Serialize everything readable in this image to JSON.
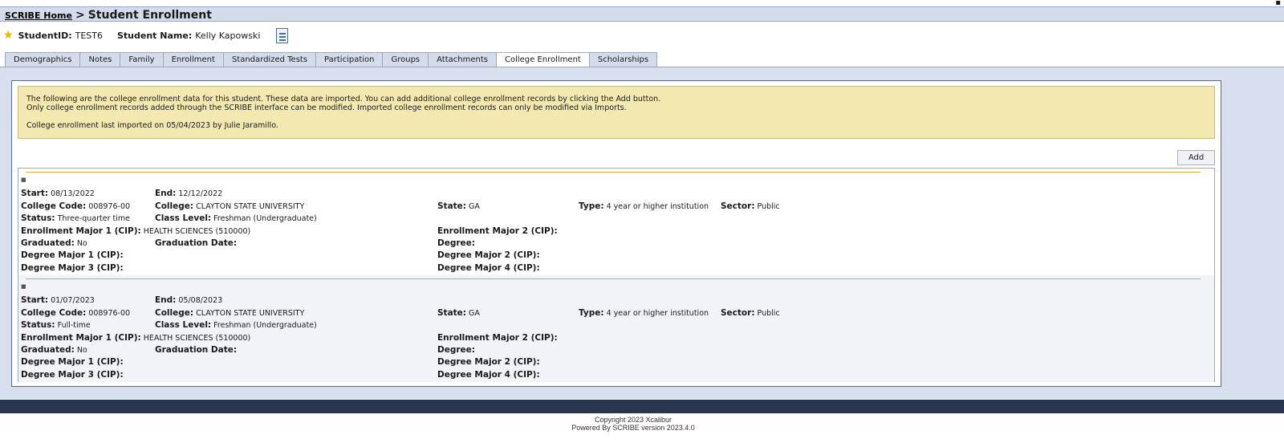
{
  "breadcrumb": {
    "home": "SCRIBE Home",
    "separator": ">",
    "title": "Student Enrollment"
  },
  "student": {
    "id_label": "StudentID:",
    "id_value": "TEST6",
    "name_label": "Student Name:",
    "name_value": "Kelly Kapowski"
  },
  "tabs": [
    "Demographics",
    "Notes",
    "Family",
    "Enrollment",
    "Standardized Tests",
    "Participation",
    "Groups",
    "Attachments",
    "College Enrollment",
    "Scholarships"
  ],
  "active_tab": "College Enrollment",
  "notice": {
    "line1": "The following are the college enrollment data for this student. These data are imported.  You can add additional college enrollment records by clicking the Add button.",
    "line2": "Only college enrollment records added through the SCRIBE interface can be modified. Imported college enrollment records can only be modified via Imports.",
    "line3": "College enrollment last imported on 05/04/2023 by Julie Jaramillo."
  },
  "add_label": "Add",
  "labels": {
    "start": "Start:",
    "end": "End:",
    "college_code": "College Code:",
    "college": "College:",
    "state": "State:",
    "type": "Type:",
    "sector": "Sector:",
    "status": "Status:",
    "class_level": "Class Level:",
    "enroll_major1": "Enrollment Major 1 (CIP):",
    "enroll_major2": "Enrollment Major 2 (CIP):",
    "graduated": "Graduated:",
    "graduation_date": "Graduation Date:",
    "degree": "Degree:",
    "degree_major1": "Degree Major 1 (CIP):",
    "degree_major2": "Degree Major 2 (CIP):",
    "degree_major3": "Degree Major 3 (CIP):",
    "degree_major4": "Degree Major 4 (CIP):"
  },
  "records": [
    {
      "start": "08/13/2022",
      "end": "12/12/2022",
      "college_code": "008976-00",
      "college": "CLAYTON STATE UNIVERSITY",
      "state": "GA",
      "type": "4 year or higher institution",
      "sector": "Public",
      "status": "Three-quarter time",
      "class_level": "Freshman (Undergraduate)",
      "enroll_major1": "HEALTH SCIENCES (510000)",
      "graduated": "No"
    },
    {
      "start": "01/07/2023",
      "end": "05/08/2023",
      "college_code": "008976-00",
      "college": "CLAYTON STATE UNIVERSITY",
      "state": "GA",
      "type": "4 year or higher institution",
      "sector": "Public",
      "status": "Full-time",
      "class_level": "Freshman (Undergraduate)",
      "enroll_major1": "HEALTH SCIENCES (510000)",
      "graduated": "No"
    }
  ],
  "footer": {
    "line1": "Copyright 2023 Xcalibur",
    "line2": "Powered By SCRIBE version 2023.4.0"
  }
}
